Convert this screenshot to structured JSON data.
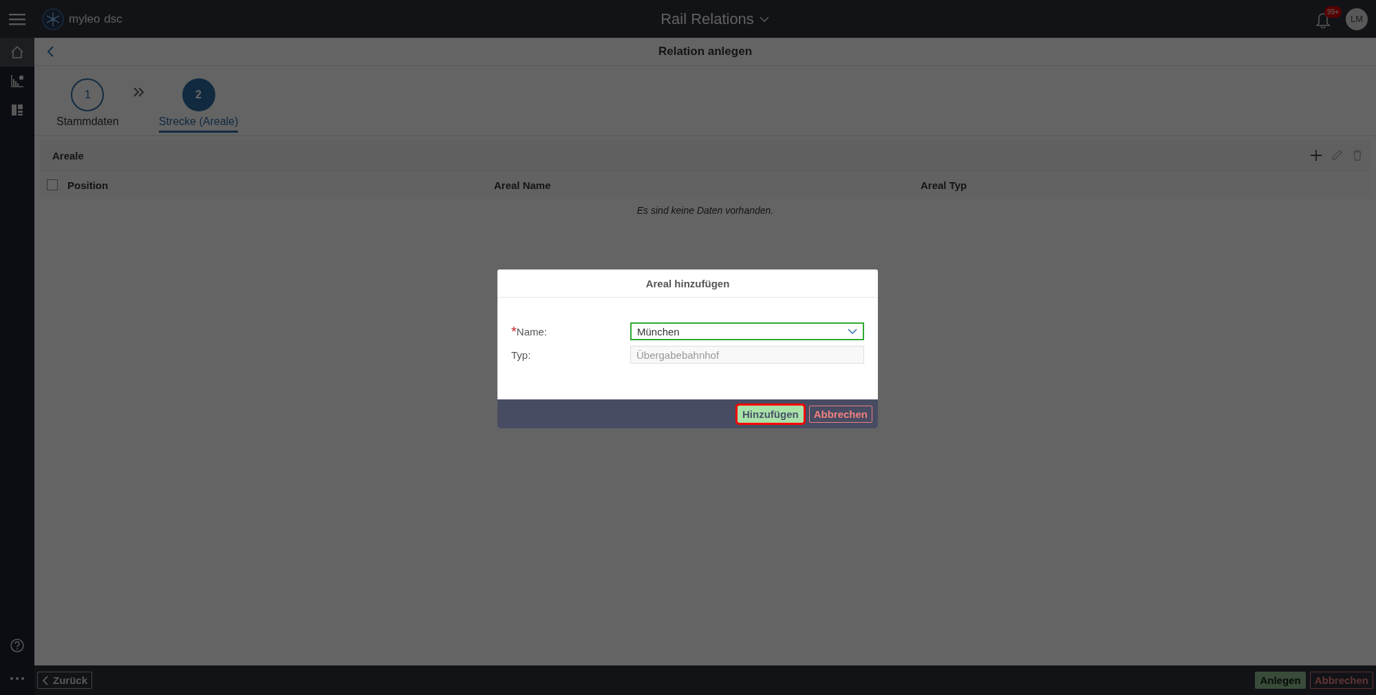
{
  "app": {
    "logo_text": "myleo",
    "logo_suffix": "dsc",
    "title": "Rail Relations",
    "notification_badge": "99+",
    "avatar_initials": "LM"
  },
  "sidebar": {
    "items": [
      {
        "kind": "home",
        "selected": true
      },
      {
        "kind": "chart",
        "selected": false
      },
      {
        "kind": "dashboard",
        "selected": false
      }
    ]
  },
  "page": {
    "title": "Relation anlegen"
  },
  "steps": [
    {
      "number": "1",
      "label": "Stammdaten",
      "selected": false
    },
    {
      "number": "2",
      "label": "Strecke (Areale)",
      "selected": true
    }
  ],
  "table": {
    "title": "Areale",
    "select_all_checked": false,
    "columns": [
      "Position",
      "Areal Name",
      "Areal Typ"
    ],
    "empty_message": "Es sind keine Daten vorhanden."
  },
  "dialog": {
    "title": "Areal hinzufügen",
    "fields": [
      {
        "kind": "select",
        "required_marker": "*",
        "label": "Name:",
        "disabled": false,
        "value": "München"
      },
      {
        "kind": "text",
        "label": "Typ:",
        "disabled": true,
        "value": "Übergabebahnhof"
      }
    ],
    "buttons": [
      {
        "kind": "primary",
        "label": "Hinzufügen",
        "focused": true
      },
      {
        "kind": "cancel",
        "label": "Abbrechen",
        "focused": false
      }
    ]
  },
  "footer": {
    "back_button": "Zurück",
    "buttons": [
      {
        "kind": "primary",
        "label": "Anlegen",
        "disabled": true
      },
      {
        "kind": "cancel",
        "label": "Abbrechen",
        "disabled": false
      }
    ]
  }
}
